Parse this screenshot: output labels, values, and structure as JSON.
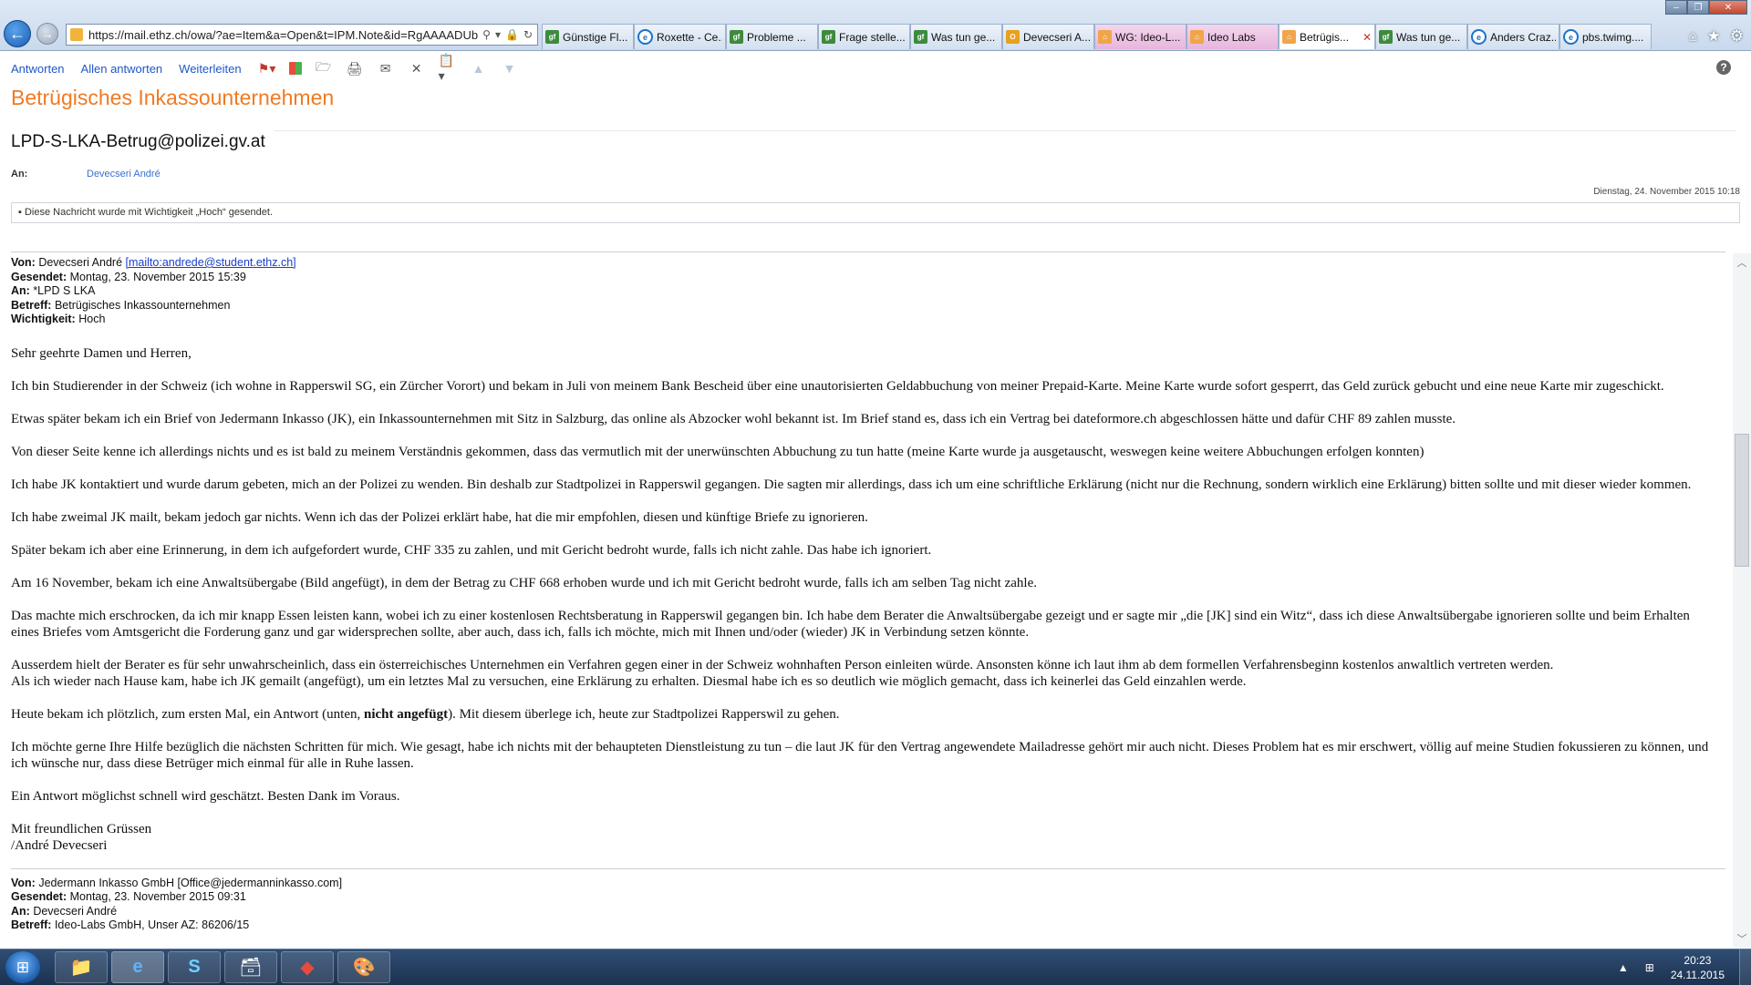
{
  "browser": {
    "url": "https://mail.ethz.ch/owa/?ae=Item&a=Open&t=IPM.Note&id=RgAAAADUbK5R",
    "tabs": [
      {
        "title": "Günstige Fl...",
        "icon": "gf"
      },
      {
        "title": "Roxette - Ce...",
        "icon": "ie"
      },
      {
        "title": "Probleme ...",
        "icon": "gf"
      },
      {
        "title": "Frage stelle...",
        "icon": "gf"
      },
      {
        "title": "Was tun ge...",
        "icon": "gf"
      },
      {
        "title": "Devecseri A...",
        "icon": "ow"
      },
      {
        "title": "WG: Ideo-L...",
        "icon": "home"
      },
      {
        "title": "Ideo Labs",
        "icon": "home"
      },
      {
        "title": "Betrügis...",
        "icon": "home",
        "active": true
      },
      {
        "title": "Was tun ge...",
        "icon": "gf"
      },
      {
        "title": "Anders Craz...",
        "icon": "ie"
      },
      {
        "title": "pbs.twimg....",
        "icon": "ie"
      }
    ]
  },
  "toolbar": {
    "reply": "Antworten",
    "reply_all": "Allen antworten",
    "forward": "Weiterleiten"
  },
  "message": {
    "subject": "Betrügisches Inkassounternehmen",
    "sender": "LPD-S-LKA-Betrug@polizei.gv.at",
    "to_label": "An:",
    "to_value": "Devecseri André",
    "date": "Dienstag, 24. November 2015 10:18",
    "importance_note": "Diese Nachricht wurde mit Wichtigkeit „Hoch“ gesendet."
  },
  "quoted": {
    "from_label": "Von:",
    "from_value": "Devecseri André",
    "from_mailto": "[mailto:andrede@student.ethz.ch]",
    "sent_label": "Gesendet:",
    "sent_value": "Montag, 23. November 2015 15:39",
    "to_label": "An:",
    "to_value": "*LPD S LKA",
    "subject_label": "Betreff:",
    "subject_value": "Betrügisches Inkassounternehmen",
    "importance_label": "Wichtigkeit:",
    "importance_value": "Hoch"
  },
  "body": {
    "p1": "Sehr geehrte Damen und Herren,",
    "p2": "Ich bin Studierender in der Schweiz (ich wohne in Rapperswil SG, ein Zürcher Vorort) und bekam in Juli von meinem Bank Bescheid über eine unautorisierten Geldabbuchung von meiner Prepaid-Karte. Meine Karte wurde sofort gesperrt, das Geld zurück gebucht und eine neue Karte mir zugeschickt.",
    "p3": "Etwas später bekam ich ein Brief von Jedermann Inkasso (JK), ein Inkassounternehmen mit Sitz in Salzburg, das online als Abzocker wohl bekannt ist. Im Brief stand es, dass ich ein Vertrag bei dateformore.ch abgeschlossen hätte und dafür CHF 89 zahlen musste.",
    "p4": "Von dieser Seite kenne ich allerdings nichts und es ist bald zu meinem Verständnis gekommen, dass das vermutlich mit der unerwünschten Abbuchung zu tun hatte (meine Karte wurde ja ausgetauscht, weswegen keine weitere Abbuchungen erfolgen konnten)",
    "p5": "Ich habe JK kontaktiert und wurde darum gebeten, mich an der Polizei zu wenden. Bin deshalb zur Stadtpolizei in Rapperswil gegangen. Die sagten mir allerdings, dass ich um eine schriftliche Erklärung (nicht nur die Rechnung, sondern wirklich eine Erklärung) bitten sollte und mit dieser wieder kommen.",
    "p6": "Ich habe zweimal JK mailt, bekam jedoch gar nichts. Wenn ich das der Polizei erklärt habe, hat die mir empfohlen, diesen und künftige Briefe zu ignorieren.",
    "p7": "Später bekam ich aber eine Erinnerung, in dem ich aufgefordert wurde, CHF 335 zu zahlen, und mit Gericht bedroht wurde, falls ich nicht zahle. Das habe ich ignoriert.",
    "p8": "Am 16 November, bekam ich eine Anwaltsübergabe (Bild angefügt), in dem der Betrag zu CHF 668 erhoben wurde und ich mit Gericht bedroht wurde, falls ich am selben Tag nicht zahle.",
    "p9": "Das machte mich erschrocken, da ich mir knapp Essen leisten kann, wobei ich zu einer kostenlosen Rechtsberatung in Rapperswil gegangen bin. Ich habe dem Berater die Anwaltsübergabe gezeigt und er sagte mir „die [JK] sind ein Witz“, dass ich diese Anwaltsübergabe ignorieren sollte und beim Erhalten eines Briefes vom Amtsgericht die Forderung ganz und gar widersprechen sollte, aber auch, dass ich, falls ich möchte, mich mit Ihnen und/oder (wieder) JK in Verbindung setzen könnte.",
    "p10a": "Ausserdem hielt der Berater es für sehr unwahrscheinlich, dass ein österreichisches Unternehmen ein Verfahren gegen einer in der Schweiz wohnhaften Person einleiten würde. Ansonsten könne ich laut ihm ab dem formellen Verfahrensbeginn kostenlos anwaltlich vertreten werden.",
    "p10b": "Als ich wieder nach Hause kam, habe ich JK gemailt (angefügt), um ein letztes Mal zu versuchen, eine Erklärung zu erhalten. Diesmal habe ich es so deutlich wie möglich gemacht, dass ich keinerlei das Geld einzahlen werde.",
    "p11_pre": "Heute bekam ich plötzlich, zum ersten Mal, ein Antwort (unten, ",
    "p11_bold": "nicht angefügt",
    "p11_post": "). Mit diesem überlege ich, heute zur Stadtpolizei Rapperswil zu gehen.",
    "p12": "Ich möchte gerne Ihre Hilfe bezüglich die nächsten Schritten für mich. Wie gesagt, habe ich nichts mit der behaupteten Dienstleistung zu tun – die laut JK für den Vertrag angewendete Mailadresse gehört mir auch nicht. Dieses Problem hat es mir erschwert, völlig auf meine Studien fokussieren zu können, und ich wünsche nur, dass diese Betrüger mich einmal für alle in Ruhe lassen.",
    "p13": "Ein Antwort möglichst schnell wird geschätzt. Besten Dank im Voraus.",
    "p14a": "Mit freundlichen Grüssen",
    "p14b": "/André Devecseri"
  },
  "quoted2": {
    "from_label": "Von:",
    "from_value": "Jedermann Inkasso GmbH [Office@jedermanninkasso.com]",
    "sent_label": "Gesendet:",
    "sent_value": "Montag, 23. November 2015 09:31",
    "to_label": "An:",
    "to_value": "Devecseri André",
    "subject_label": "Betreff:",
    "subject_value": "Ideo-Labs GmbH, Unser AZ: 86206/15"
  },
  "taskbar": {
    "time": "20:23",
    "date": "24.11.2015"
  }
}
